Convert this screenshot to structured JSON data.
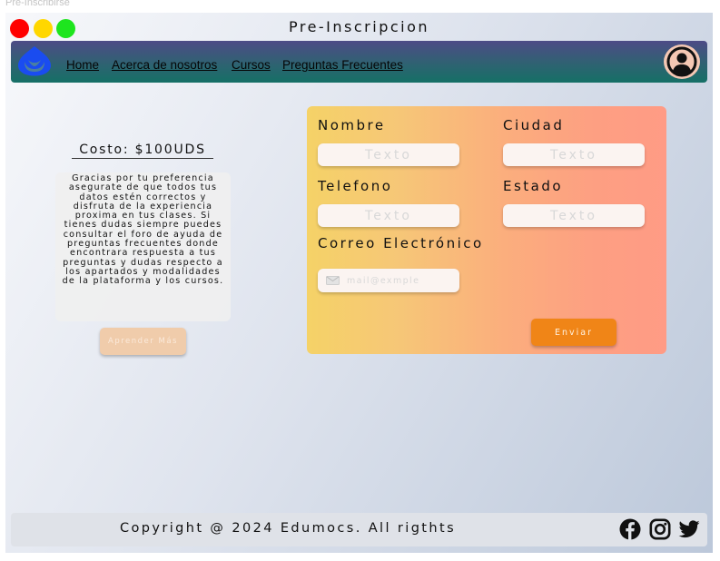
{
  "page_label": "Pre-Inscribirse",
  "window": {
    "title": "Pre-Inscripcion"
  },
  "nav": {
    "links": [
      "Home",
      "Acerca de nosotros",
      "Cursos",
      "Preguntas Frecuentes"
    ],
    "logo_icon": "drop-logo-icon",
    "avatar_icon": "user-circle-icon"
  },
  "info": {
    "cost": "Costo: $100UDS",
    "text": "Gracias por tu preferencia asegurate de que todos tus datos estén correctos y disfruta de la experiencia proxima en tus clases. Si tienes dudas siempre puedes consultar el foro de ayuda de preguntas frecuentes donde encontrara respuesta a tus preguntas y dudas respecto a los apartados y modalidades de la plataforma y los cursos.",
    "learn_more": "Aprender Más"
  },
  "form": {
    "nombre_label": "Nombre",
    "ciudad_label": "Ciudad",
    "telefono_label": "Telefono",
    "estado_label": "Estado",
    "correo_label": "Correo Electrónico",
    "text_placeholder": "Texto",
    "email_placeholder": "mail@exmple",
    "email_icon": "mail-icon",
    "submit": "Enviar"
  },
  "footer": {
    "copyright": "Copyright @ 2024 Edumocs. All rigthts",
    "social_icons": [
      "facebook-icon",
      "instagram-icon",
      "twitter-icon"
    ]
  },
  "colors": {
    "nav_gradient": [
      "#4d4b86",
      "#157066"
    ],
    "form_gradient": [
      "#f5d267",
      "#ff9b85"
    ],
    "submit": "#f08517",
    "learn_more": "#f0ccab",
    "logo": "#1a4cf0"
  }
}
